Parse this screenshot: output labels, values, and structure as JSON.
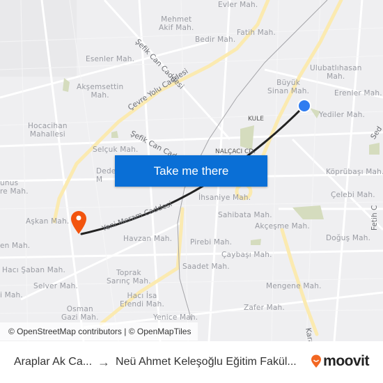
{
  "map": {
    "neighborhoods": [
      {
        "name": "Evler Mah."
      },
      {
        "name": "Mehmet\nAkif Mah."
      },
      {
        "name": "Fatih Mah."
      },
      {
        "name": "Bedir Mah."
      },
      {
        "name": "Esenler Mah."
      },
      {
        "name": "Ulubatlıhasan\nMah."
      },
      {
        "name": "Büyük\nSinan Mah."
      },
      {
        "name": "Erenler Mah."
      },
      {
        "name": "Akşemsettin\nMah."
      },
      {
        "name": "Yediler Mah."
      },
      {
        "name": "Hocacihan\nMahallesi"
      },
      {
        "name": "Selçuk Mah."
      },
      {
        "name": "Dede\nM"
      },
      {
        "name": "Köprübaşı Mah."
      },
      {
        "name": "unus\nre Mah."
      },
      {
        "name": "Çelebi Mah."
      },
      {
        "name": "İhsaniye Mah."
      },
      {
        "name": "Sahibata Mah."
      },
      {
        "name": "Aşkan Mah."
      },
      {
        "name": "Akçeşme Mah."
      },
      {
        "name": "Havzan Mah."
      },
      {
        "name": "Pirebi Mah."
      },
      {
        "name": "Doğuş Mah."
      },
      {
        "name": "en Mah."
      },
      {
        "name": "Çaybaşı Mah."
      },
      {
        "name": "Saadet Mah."
      },
      {
        "name": "Hacı Şaban Mah."
      },
      {
        "name": "Toprak\nSarınç Mah."
      },
      {
        "name": "Selver Mah."
      },
      {
        "name": "Mengene Mah."
      },
      {
        "name": "Hacı İsa\nEfendi Mah."
      },
      {
        "name": "i Mah."
      },
      {
        "name": "Zafer Mah."
      },
      {
        "name": "Osman\nGazi Mah."
      },
      {
        "name": "Yenice Mah."
      }
    ],
    "streets": [
      "Şefik Can Caddesi",
      "Çevre Yolu Caddesi",
      "Şefik Can Cadd",
      "Yeni Meram Caddesi",
      "Sed",
      "Fetih C",
      "Karar"
    ],
    "pois": [
      "KULE",
      "NALÇACI CD."
    ],
    "route_color": "#222222",
    "origin_marker_color": "#2f7cf0",
    "destination_marker_color": "#f2540e",
    "attribution": "© OpenStreetMap contributors | © OpenMapTiles"
  },
  "cta": {
    "label": "Take me there",
    "color": "#0a6fd6"
  },
  "footer": {
    "from": "Araplar Ak Ca...",
    "arrow": "→",
    "to": "Neü Ahmet Keleşoğlu Eğitim Fakül...",
    "brand": "moovit",
    "brand_color": "#f26722"
  }
}
